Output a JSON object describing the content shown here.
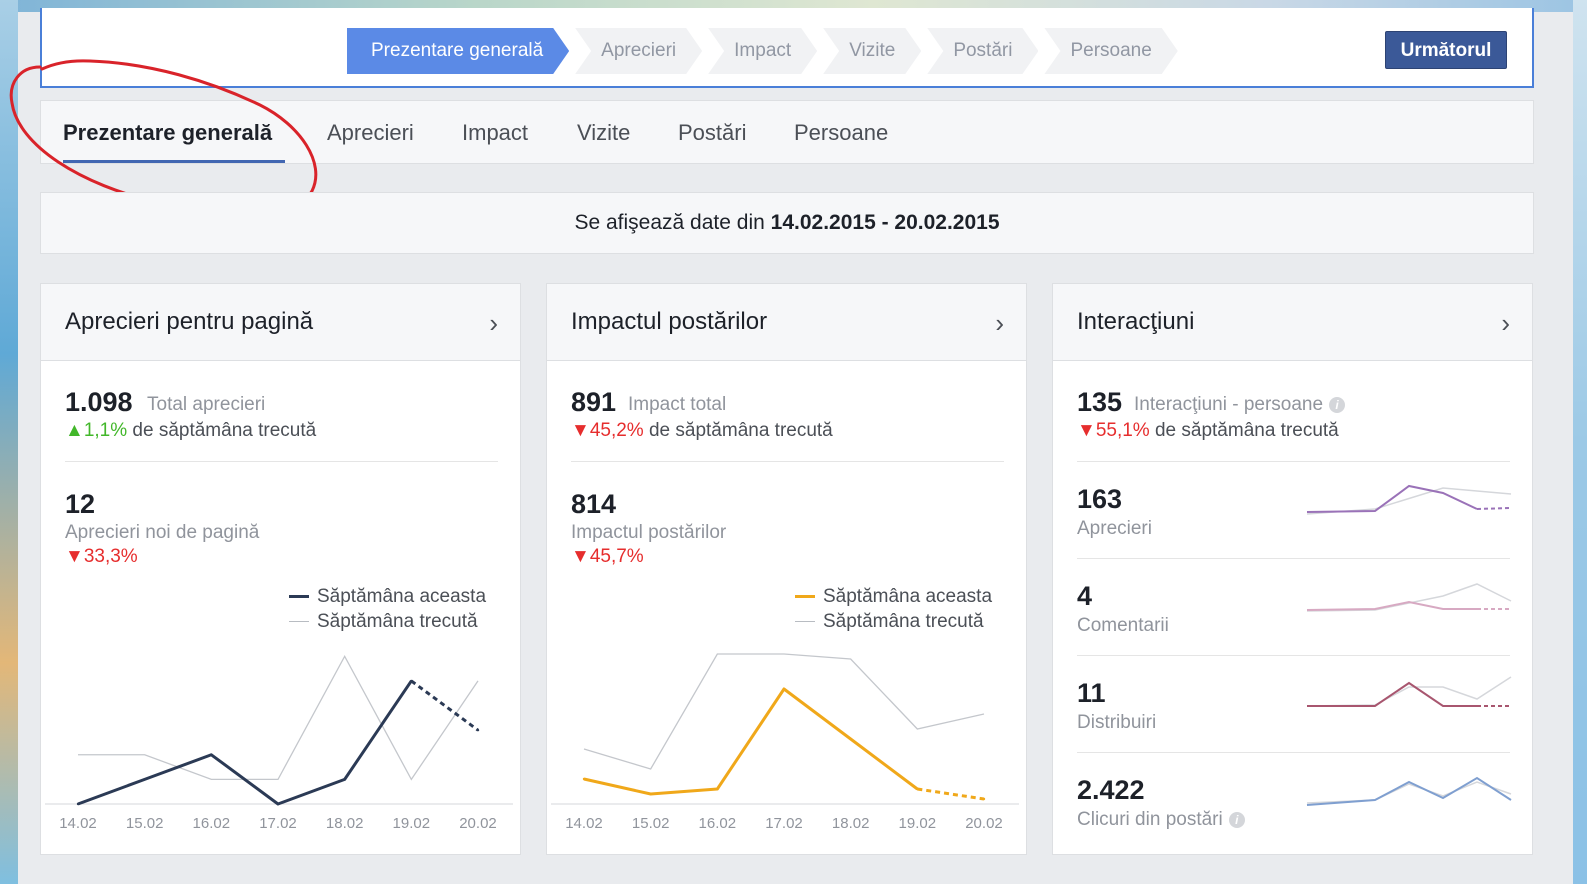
{
  "guide": {
    "steps": [
      "Prezentare generală",
      "Aprecieri",
      "Impact",
      "Vizite",
      "Postări",
      "Persoane"
    ],
    "next_label": "Următorul"
  },
  "tabs": [
    "Prezentare generală",
    "Aprecieri",
    "Impact",
    "Vizite",
    "Postări",
    "Persoane"
  ],
  "datebar": {
    "prefix": "Se afişează date din",
    "range": "14.02.2015 - 20.02.2015"
  },
  "cards": {
    "likes": {
      "title": "Aprecieri pentru pagină",
      "total_value": "1.098",
      "total_label": "Total aprecieri",
      "total_change": "1,1%",
      "total_change_suffix": "de săptămâna trecută",
      "new_value": "12",
      "new_label": "Aprecieri noi de pagină",
      "new_change": "33,3%",
      "legend_this": "Săptămâna aceasta",
      "legend_last": "Săptămâna trecută"
    },
    "reach": {
      "title": "Impactul postărilor",
      "total_value": "891",
      "total_label": "Impact total",
      "total_change": "45,2%",
      "total_change_suffix": "de săptămâna trecută",
      "new_value": "814",
      "new_label": "Impactul postărilor",
      "new_change": "45,7%",
      "legend_this": "Săptămâna aceasta",
      "legend_last": "Săptămâna trecută"
    },
    "engagement": {
      "title": "Interacţiuni",
      "total_value": "135",
      "total_label": "Interacţiuni - persoane",
      "total_change": "55,1%",
      "total_change_suffix": "de săptămâna trecută",
      "rows": [
        {
          "value": "163",
          "label": "Aprecieri"
        },
        {
          "value": "4",
          "label": "Comentarii"
        },
        {
          "value": "11",
          "label": "Distribuiri"
        },
        {
          "value": "2.422",
          "label": "Clicuri din postări"
        }
      ]
    }
  },
  "colors": {
    "likes_this": "#2b3a55",
    "reach_this": "#f0a81a",
    "last_week": "#c4c7cc",
    "spark_aprecieri": "#9a72b8",
    "spark_comentarii": "#d7a9c2",
    "spark_distribuiri": "#a8566f",
    "spark_clicuri": "#7f9fd0"
  },
  "chart_data": [
    {
      "type": "line",
      "x": [
        "14.02",
        "15.02",
        "16.02",
        "17.02",
        "18.02",
        "19.02",
        "20.02"
      ],
      "series": [
        {
          "name": "Săptămâna aceasta",
          "values": [
            0,
            1,
            2,
            0,
            1,
            5,
            3
          ]
        },
        {
          "name": "Săptămâna trecută",
          "values": [
            2,
            2,
            1,
            1,
            6,
            1,
            5
          ]
        }
      ],
      "ylim": [
        0,
        6.5
      ]
    },
    {
      "type": "line",
      "x": [
        "14.02",
        "15.02",
        "16.02",
        "17.02",
        "18.02",
        "19.02",
        "20.02"
      ],
      "series": [
        {
          "name": "Săptămâna aceasta",
          "values": [
            25,
            10,
            15,
            115,
            65,
            15,
            5
          ]
        },
        {
          "name": "Săptămâna trecută",
          "values": [
            55,
            35,
            150,
            150,
            145,
            75,
            90
          ]
        }
      ],
      "ylim": [
        0,
        160
      ]
    }
  ]
}
